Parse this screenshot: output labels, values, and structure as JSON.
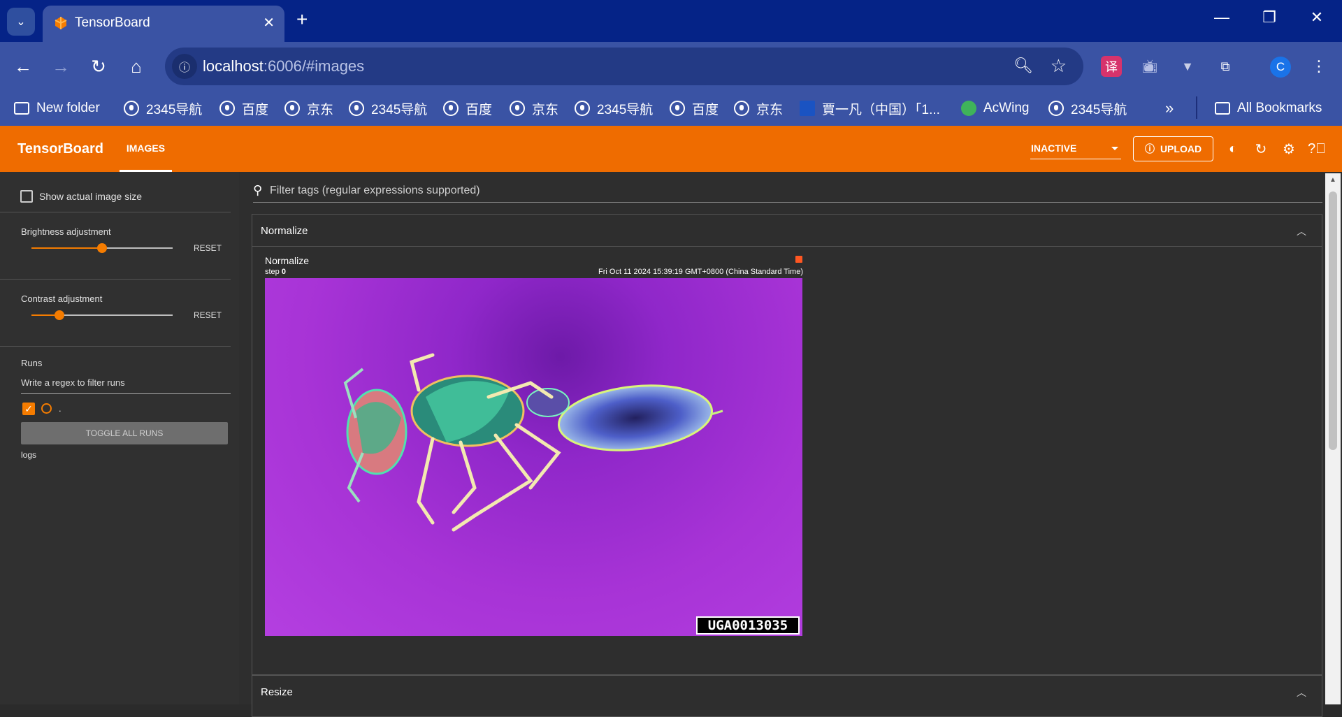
{
  "browser": {
    "tab_title": "TensorBoard",
    "url_host": "localhost",
    "url_rest": ":6006/#images",
    "avatar_letter": "C",
    "bookmarks": [
      {
        "label": "New folder",
        "icon": "folder-icon"
      },
      {
        "label": "2345导航",
        "icon": "globe-icon"
      },
      {
        "label": "百度",
        "icon": "globe-icon"
      },
      {
        "label": "京东",
        "icon": "globe-icon"
      },
      {
        "label": "2345导航",
        "icon": "globe-icon"
      },
      {
        "label": "百度",
        "icon": "globe-icon"
      },
      {
        "label": "京东",
        "icon": "globe-icon"
      },
      {
        "label": "2345导航",
        "icon": "globe-icon"
      },
      {
        "label": "百度",
        "icon": "globe-icon"
      },
      {
        "label": "京东",
        "icon": "globe-icon"
      },
      {
        "label": "賈一凡（中国）「1...",
        "icon": "nhk-icon"
      },
      {
        "label": "AcWing",
        "icon": "acwing-icon"
      },
      {
        "label": "2345导航",
        "icon": "globe-icon"
      }
    ],
    "all_bookmarks": "All Bookmarks",
    "overflow": "»"
  },
  "tensorboard": {
    "brand": "TensorBoard",
    "active_tab": "IMAGES",
    "status_select": "INACTIVE",
    "upload_label": "UPLOAD",
    "accent_color": "#ef6c00"
  },
  "sidebar": {
    "show_actual_size": "Show actual image size",
    "brightness_label": "Brightness adjustment",
    "brightness_value": 0.5,
    "contrast_label": "Contrast adjustment",
    "contrast_value": 0.2,
    "reset_label": "RESET",
    "runs_label": "Runs",
    "runs_filter_placeholder": "Write a regex to filter runs",
    "run_name": ".",
    "toggle_all": "TOGGLE ALL RUNS",
    "logs_label": "logs"
  },
  "main": {
    "filter_placeholder": "Filter tags (regular expressions supported)",
    "groups": [
      {
        "title": "Normalize",
        "card": {
          "title": "Normalize",
          "step_prefix": "step",
          "step": "0",
          "timestamp": "Fri Oct 11 2024 15:39:19 GMT+0800 (China Standard Time)",
          "specimen_id": "UGA0013035"
        }
      },
      {
        "title": "Resize"
      }
    ]
  }
}
